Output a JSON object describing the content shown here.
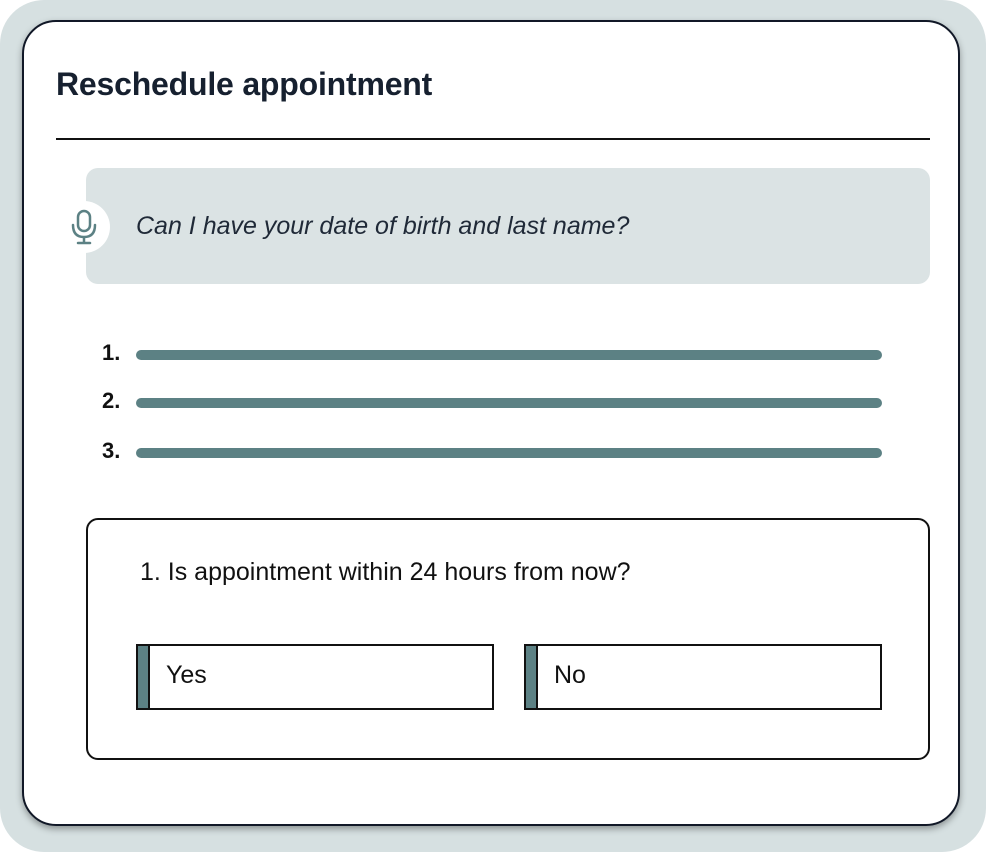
{
  "header": {
    "title": "Reschedule appointment"
  },
  "prompt": {
    "icon": "microphone-icon",
    "text": "Can I have your date of birth and last name?"
  },
  "list": {
    "items": [
      {
        "number": "1."
      },
      {
        "number": "2."
      },
      {
        "number": "3."
      }
    ]
  },
  "question": {
    "text": "1. Is appointment within 24 hours from now?",
    "options": [
      {
        "label": "Yes"
      },
      {
        "label": "No"
      }
    ]
  },
  "colors": {
    "accent": "#5c8184",
    "frame": "#d6e0e1",
    "prompt_bg": "#dbe3e4",
    "title": "#16202f"
  }
}
